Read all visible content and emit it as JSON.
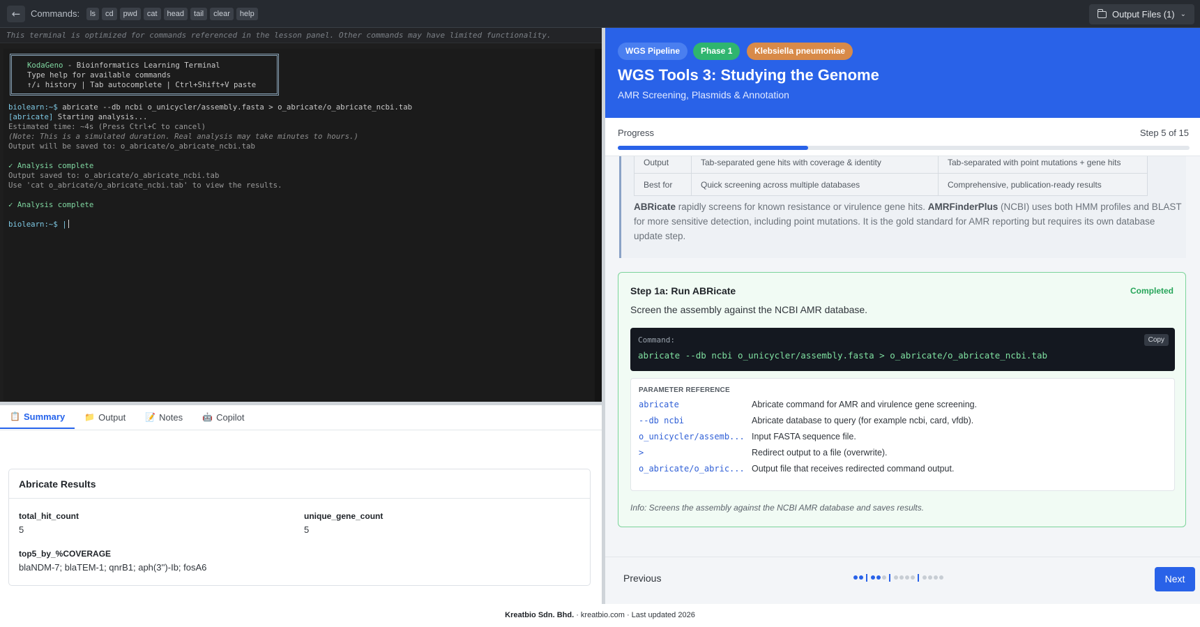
{
  "topbar": {
    "back_label": "←",
    "commands_label": "Commands:",
    "commands": [
      "ls",
      "cd",
      "pwd",
      "cat",
      "head",
      "tail",
      "clear",
      "help"
    ],
    "output_files_label": "Output Files (1)"
  },
  "terminal": {
    "notice": "This terminal is optimized for commands referenced in the lesson panel. Other commands may have limited functionality.",
    "banner": {
      "app_name": "KodaGeno",
      "app_tagline": " - Bioinformatics Learning Terminal",
      "line2": "Type help for available commands",
      "line3": "↑/↓ history | Tab autocomplete | Ctrl+Shift+V paste"
    },
    "prompt": "biolearn:~$",
    "command": " abricate --db ncbi o_unicycler/assembly.fasta > o_abricate/o_abricate_ncbi.tab",
    "tag": "[abricate]",
    "starting": " Starting analysis...",
    "estimated": "Estimated time: ~4s (Press Ctrl+C to cancel)",
    "note": "(Note: This is a simulated duration. Real analysis may take minutes to hours.)",
    "saved_to": "Output will be saved to: o_abricate/o_abricate_ncbi.tab",
    "complete1": "✓ Analysis complete",
    "output_saved": "Output saved to: o_abricate/o_abricate_ncbi.tab",
    "use_cat": "Use 'cat o_abricate/o_abricate_ncbi.tab' to view the results.",
    "complete2": "✓ Analysis complete",
    "prompt2": "biolearn:~$ |"
  },
  "bottom_tabs": [
    {
      "icon": "📋",
      "label": "Summary"
    },
    {
      "icon": "📁",
      "label": "Output"
    },
    {
      "icon": "📝",
      "label": "Notes"
    },
    {
      "icon": "🤖",
      "label": "Copilot"
    }
  ],
  "results": {
    "title": "Abricate Results",
    "total_hit_count_label": "total_hit_count",
    "total_hit_count": "5",
    "unique_gene_count_label": "unique_gene_count",
    "unique_gene_count": "5",
    "top5_label": "top5_by_%COVERAGE",
    "top5": "blaNDM-7; blaTEM-1; qnrB1; aph(3'')-Ib; fosA6"
  },
  "footer": {
    "company": "Kreatbio Sdn. Bhd.",
    "rest": "  ·  kreatbio.com  ·  Last updated 2026"
  },
  "lesson": {
    "badges": [
      "WGS Pipeline",
      "Phase 1",
      "Klebsiella pneumoniae"
    ],
    "badge_colors": [
      "#4a7ff0",
      "#2fb56f",
      "#d88a48"
    ],
    "title": "WGS Tools 3: Studying the Genome",
    "subtitle": "AMR Screening, Plasmids & Annotation",
    "progress_label": "Progress",
    "progress_step": "Step 5 of 15",
    "progress_fraction": 0.3333,
    "compare_rows": [
      {
        "label": "Output",
        "c1": "Tab-separated gene hits with coverage & identity",
        "c2": "Tab-separated with point mutations + gene hits"
      },
      {
        "label": "Best for",
        "c1": "Quick screening across multiple databases",
        "c2": "Comprehensive, publication-ready results"
      }
    ],
    "para_b1": "ABRicate",
    "para_t1": " rapidly screens for known resistance or virulence gene hits. ",
    "para_b2": "AMRFinderPlus",
    "para_t2": " (NCBI) uses both HMM profiles and BLAST for more sensitive detection, including point mutations. It is the gold standard for AMR reporting but requires its own database update step.",
    "step": {
      "title": "Step 1a: Run ABRicate",
      "status": "Completed",
      "description": "Screen the assembly against the NCBI AMR database.",
      "command_caption": "Command:",
      "command": "abricate --db ncbi o_unicycler/assembly.fasta > o_abricate/o_abricate_ncbi.tab",
      "copy_label": "Copy",
      "param_caption": "PARAMETER REFERENCE",
      "params": [
        {
          "name": "abricate",
          "desc": "Abricate command for AMR and virulence gene screening."
        },
        {
          "name": "--db ncbi",
          "desc": "Abricate database to query (for example ncbi, card, vfdb)."
        },
        {
          "name": "o_unicycler/assemb...",
          "desc": "Input FASTA sequence file."
        },
        {
          "name": ">",
          "desc": "Redirect output to a file (overwrite)."
        },
        {
          "name": "o_abricate/o_abric...",
          "desc": "Output file that receives redirected command output."
        }
      ],
      "info": "Info: Screens the assembly against the NCBI AMR database and saves results."
    },
    "prev_label": "Previous",
    "next_label": "Next"
  }
}
